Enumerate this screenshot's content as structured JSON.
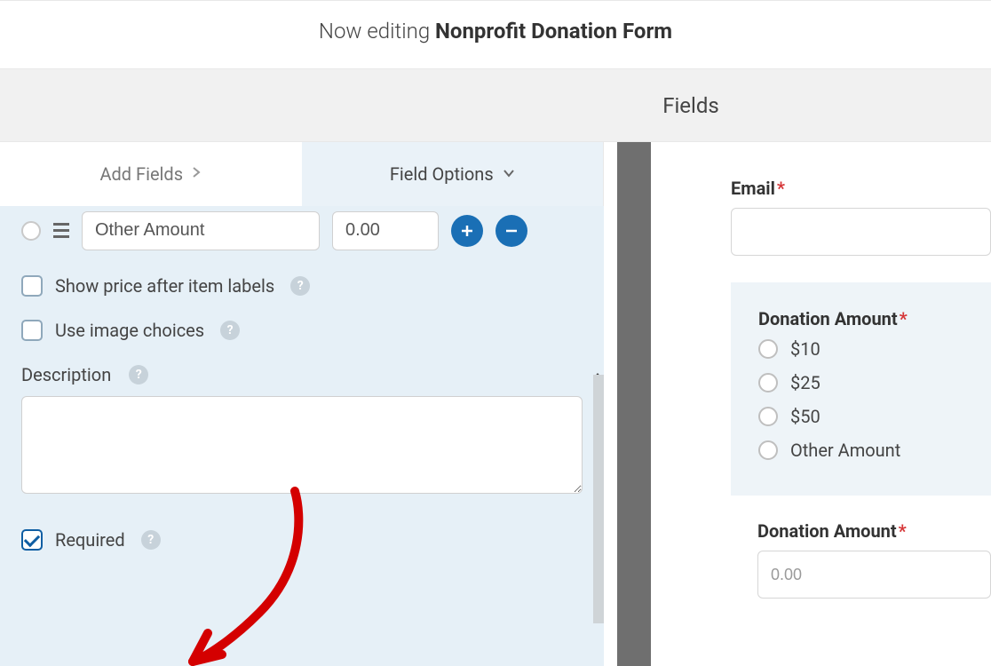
{
  "header": {
    "editing_prefix": "Now editing ",
    "form_name": "Nonprofit Donation Form"
  },
  "subheader": {
    "title": "Fields"
  },
  "tabs": {
    "add_fields": "Add Fields",
    "field_options": "Field Options"
  },
  "options": {
    "choice": {
      "label_value": "Other Amount",
      "price_value": "0.00"
    },
    "show_price_label": "Show price after item labels",
    "use_image_label": "Use image choices",
    "description_label": "Description",
    "required_label": "Required",
    "required_checked": true
  },
  "preview": {
    "email_label": "Email",
    "donation_label": "Donation Amount",
    "amounts": [
      "$10",
      "$25",
      "$50",
      "Other Amount"
    ],
    "second_donation_label": "Donation Amount",
    "second_value": "0.00"
  }
}
